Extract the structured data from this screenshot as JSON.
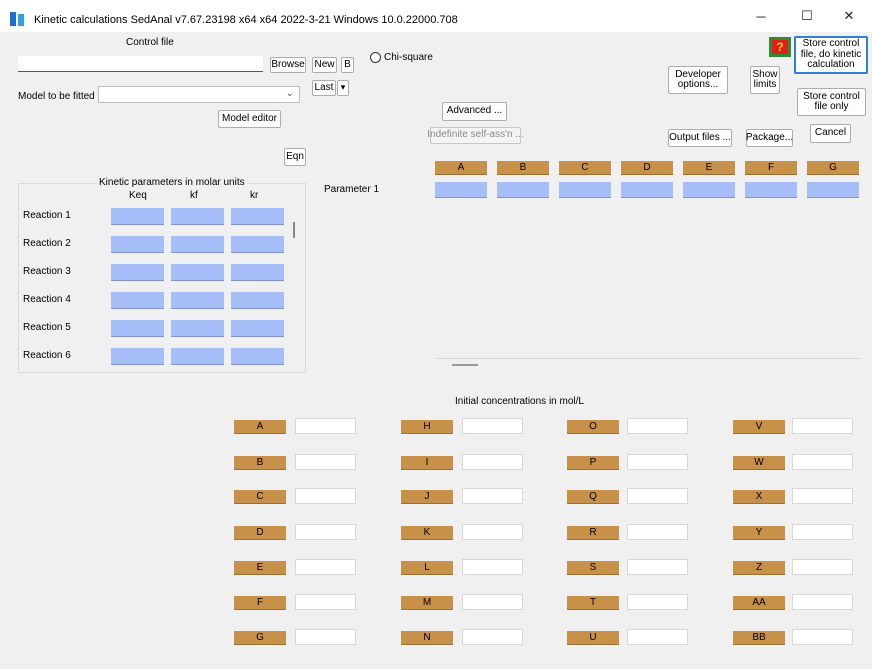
{
  "window": {
    "title": "Kinetic calculations  SedAnal v7.67.23198 x64 x64 2022-3-21 Windows 10.0.22000.708",
    "minimize": "─",
    "maximize": "☐",
    "close": "✕"
  },
  "control_file": {
    "label": "Control file",
    "value": "",
    "browse": "Browse",
    "new": "New",
    "b": "B",
    "last": "Last",
    "last_arrow": "▾",
    "chi_square": "Chi-square"
  },
  "model": {
    "label": "Model to be fitted",
    "value": "",
    "arrow": "⌄",
    "editor": "Model editor",
    "eqn": "Eqn"
  },
  "buttons": {
    "help": "?",
    "store_do": "Store control file, do kinetic calculation",
    "store_only": "Store control file only",
    "cancel": "Cancel",
    "developer": "Developer options...",
    "show_limits": "Show limits",
    "advanced": "Advanced ...",
    "indefinite": "Indefinite self-ass'n ...",
    "output_files": "Output files ...",
    "package": "Package..."
  },
  "kinetic": {
    "title": "Kinetic parameters in molar units",
    "columns": [
      "Keq",
      "kf",
      "kr"
    ],
    "reactions": [
      "Reaction 1",
      "Reaction 2",
      "Reaction 3",
      "Reaction 4",
      "Reaction 5",
      "Reaction 6"
    ]
  },
  "parameter": {
    "label": "Parameter 1",
    "columns": [
      "A",
      "B",
      "C",
      "D",
      "E",
      "F",
      "G"
    ]
  },
  "concentrations": {
    "title": "Initial concentrations in mol/L",
    "columns": [
      [
        "A",
        "B",
        "C",
        "D",
        "E",
        "F",
        "G"
      ],
      [
        "H",
        "I",
        "J",
        "K",
        "L",
        "M",
        "N"
      ],
      [
        "O",
        "P",
        "Q",
        "R",
        "S",
        "T",
        "U"
      ],
      [
        "V",
        "W",
        "X",
        "Y",
        "Z",
        "AA",
        "BB"
      ]
    ]
  }
}
